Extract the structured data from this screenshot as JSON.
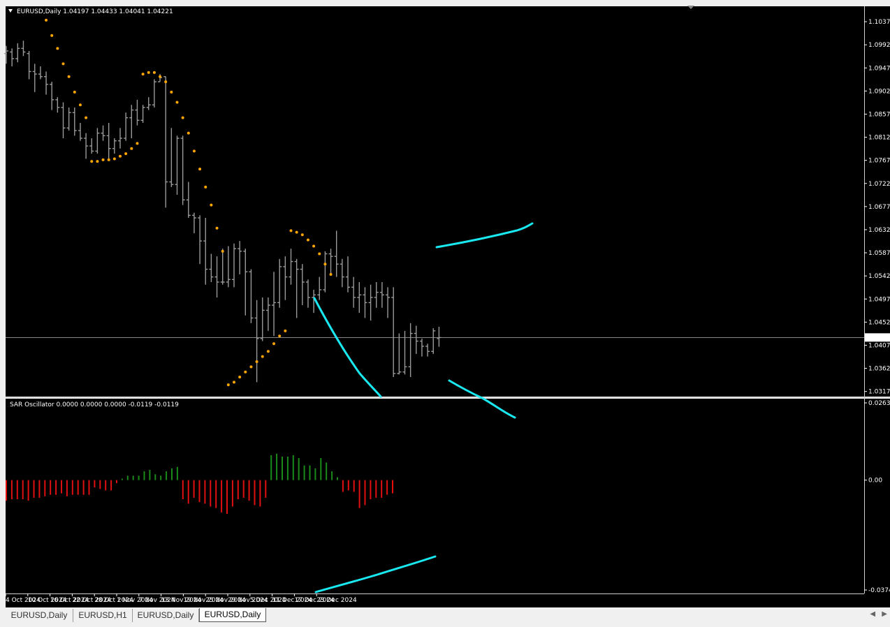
{
  "window": {
    "symbol_header": "EURUSD,Daily",
    "ohlc": "1.04197 1.04433 1.04041 1.04221"
  },
  "oscillator": {
    "header": "SAR Oscillator 0.0000 0.0000 0.0000 -0.0119 -0.0119"
  },
  "tabs": [
    {
      "label": "EURUSD,Daily",
      "active": false
    },
    {
      "label": "EURUSD,H1",
      "active": false
    },
    {
      "label": "EURUSD,Daily",
      "active": false
    },
    {
      "label": "EURUSD,Daily",
      "active": true
    }
  ],
  "colors": {
    "background": "#000000",
    "bars": "#9a9a9a",
    "sar_dots": "#ffa500",
    "osc_positive": "#1a8a1a",
    "osc_negative": "#e01010",
    "trendlines": "#19e8f0",
    "grid_line": "#b0b0b0",
    "tab_background": "#f0f0f0"
  },
  "chart_data": [
    {
      "type": "ohlc",
      "name": "EURUSD,Daily",
      "current_price": 1.04221,
      "current_price_label": "1.04221",
      "y_ticks": [
        "1.10370",
        "1.09920",
        "1.09470",
        "1.09020",
        "1.08570",
        "1.08120",
        "1.07670",
        "1.07220",
        "1.06770",
        "1.06320",
        "1.05870",
        "1.05420",
        "1.04970",
        "1.04520",
        "1.04070",
        "1.03620",
        "1.03170"
      ],
      "ylim": [
        1.0307,
        1.1067
      ],
      "x_labels": [
        {
          "label": "4 Oct 2024",
          "index": 0
        },
        {
          "label": "10 Oct 2024",
          "index": 4
        },
        {
          "label": "16 Oct 2024",
          "index": 8
        },
        {
          "label": "22 Oct 2024",
          "index": 12
        },
        {
          "label": "28 Oct 2024",
          "index": 16
        },
        {
          "label": "1 Nov 2024",
          "index": 20
        },
        {
          "label": "7 Nov 2024",
          "index": 24
        },
        {
          "label": "13 Nov 2024",
          "index": 28
        },
        {
          "label": "19 Nov 2024",
          "index": 32
        },
        {
          "label": "25 Nov 2024",
          "index": 36
        },
        {
          "label": "29 Nov 2024",
          "index": 40
        },
        {
          "label": "5 Dec 2024",
          "index": 44
        },
        {
          "label": "11 Dec 2024",
          "index": 48
        },
        {
          "label": "17 Dec 2024",
          "index": 52
        },
        {
          "label": "23 Dec 2024",
          "index": 56
        }
      ],
      "ohlc": [
        [
          1.0975,
          1.099,
          1.0955,
          1.098
        ],
        [
          1.0978,
          1.0985,
          1.095,
          1.0965
        ],
        [
          1.0965,
          1.0995,
          1.0958,
          1.0985
        ],
        [
          1.0985,
          1.1,
          1.097,
          1.0978
        ],
        [
          1.0975,
          1.098,
          1.0925,
          1.094
        ],
        [
          1.094,
          1.0955,
          1.09,
          1.0935
        ],
        [
          1.0935,
          1.095,
          1.0925,
          1.093
        ],
        [
          1.093,
          1.094,
          1.0895,
          1.0915
        ],
        [
          1.0915,
          1.092,
          1.0865,
          1.0885
        ],
        [
          1.0885,
          1.089,
          1.086,
          1.087
        ],
        [
          1.087,
          1.088,
          1.081,
          1.083
        ],
        [
          1.083,
          1.087,
          1.0825,
          1.086
        ],
        [
          1.086,
          1.087,
          1.0815,
          1.0825
        ],
        [
          1.0825,
          1.084,
          1.0805,
          1.081
        ],
        [
          1.081,
          1.082,
          1.077,
          1.0795
        ],
        [
          1.0795,
          1.081,
          1.078,
          1.0785
        ],
        [
          1.0785,
          1.083,
          1.078,
          1.082
        ],
        [
          1.082,
          1.0835,
          1.0805,
          1.0815
        ],
        [
          1.0815,
          1.084,
          1.077,
          1.079
        ],
        [
          1.079,
          1.081,
          1.078,
          1.0805
        ],
        [
          1.0805,
          1.083,
          1.079,
          1.081
        ],
        [
          1.081,
          1.086,
          1.0805,
          1.085
        ],
        [
          1.085,
          1.0875,
          1.081,
          1.0865
        ],
        [
          1.0865,
          1.0885,
          1.0835,
          1.0845
        ],
        [
          1.0845,
          1.0875,
          1.084,
          1.087
        ],
        [
          1.087,
          1.089,
          1.0865,
          1.0875
        ],
        [
          1.0875,
          1.0925,
          1.087,
          1.092
        ],
        [
          1.092,
          1.0935,
          1.092,
          1.0928
        ],
        [
          1.093,
          1.093,
          1.0675,
          1.0725
        ],
        [
          1.0725,
          1.083,
          1.0715,
          1.072
        ],
        [
          1.072,
          1.0815,
          1.07,
          1.081
        ],
        [
          1.081,
          1.0815,
          1.068,
          1.069
        ],
        [
          1.069,
          1.0725,
          1.0655,
          1.066
        ],
        [
          1.066,
          1.0665,
          1.0625,
          1.0655
        ],
        [
          1.0655,
          1.066,
          1.0565,
          1.061
        ],
        [
          1.061,
          1.0655,
          1.0525,
          1.0555
        ],
        [
          1.0555,
          1.0585,
          1.053,
          1.054
        ],
        [
          1.054,
          1.058,
          1.05,
          1.053
        ],
        [
          1.053,
          1.0595,
          1.0525,
          1.053
        ],
        [
          1.053,
          1.06,
          1.052,
          1.0535
        ],
        [
          1.0535,
          1.0605,
          1.052,
          1.0595
        ],
        [
          1.0595,
          1.061,
          1.0545,
          1.059
        ],
        [
          1.059,
          1.0595,
          1.0465,
          1.055
        ],
        [
          1.055,
          1.0555,
          1.045,
          1.046
        ],
        [
          1.046,
          1.0495,
          1.0335,
          1.042
        ],
        [
          1.042,
          1.05,
          1.0415,
          1.0475
        ],
        [
          1.0475,
          1.05,
          1.0435,
          1.0485
        ],
        [
          1.0485,
          1.055,
          1.0425,
          1.049
        ],
        [
          1.049,
          1.0575,
          1.048,
          1.056
        ],
        [
          1.056,
          1.058,
          1.0495,
          1.054
        ],
        [
          1.054,
          1.0595,
          1.0525,
          1.057
        ],
        [
          1.057,
          1.0575,
          1.046,
          1.0555
        ],
        [
          1.0555,
          1.0565,
          1.0485,
          1.053
        ],
        [
          1.053,
          1.0535,
          1.048,
          1.05
        ],
        [
          1.05,
          1.0515,
          1.047,
          1.0505
        ],
        [
          1.0505,
          1.054,
          1.0495,
          1.0515
        ],
        [
          1.0515,
          1.059,
          1.051,
          1.0585
        ],
        [
          1.0585,
          1.0595,
          1.0545,
          1.058
        ],
        [
          1.058,
          1.063,
          1.054,
          1.0565
        ],
        [
          1.0565,
          1.0575,
          1.052,
          1.054
        ],
        [
          1.054,
          1.058,
          1.051,
          1.052
        ],
        [
          1.052,
          1.054,
          1.048,
          1.05
        ],
        [
          1.05,
          1.053,
          1.047,
          1.0505
        ],
        [
          1.0505,
          1.052,
          1.046,
          1.049
        ],
        [
          1.049,
          1.0525,
          1.0455,
          1.05
        ],
        [
          1.05,
          1.053,
          1.048,
          1.051
        ],
        [
          1.051,
          1.053,
          1.048,
          1.0505
        ],
        [
          1.0505,
          1.052,
          1.046,
          1.05
        ],
        [
          1.05,
          1.052,
          1.0345,
          1.0352
        ],
        [
          1.0352,
          1.043,
          1.035,
          1.0355
        ],
        [
          1.0355,
          1.0435,
          1.035,
          1.0365
        ],
        [
          1.0365,
          1.045,
          1.0345,
          1.043
        ],
        [
          1.043,
          1.0445,
          1.039,
          1.0415
        ],
        [
          1.0415,
          1.042,
          1.0385,
          1.0405
        ],
        [
          1.0405,
          1.041,
          1.0385,
          1.0395
        ],
        [
          1.0395,
          1.044,
          1.039,
          1.0435
        ],
        [
          1.042,
          1.0443,
          1.0404,
          1.0422
        ]
      ],
      "sar": [
        [
          7,
          1.104
        ],
        [
          8,
          1.101
        ],
        [
          9,
          1.0985
        ],
        [
          10,
          1.0955
        ],
        [
          11,
          1.093
        ],
        [
          12,
          1.09
        ],
        [
          13,
          1.0875
        ],
        [
          14,
          1.085
        ],
        [
          15,
          1.0765
        ],
        [
          16,
          1.0765
        ],
        [
          17,
          1.0768
        ],
        [
          18,
          1.0768
        ],
        [
          19,
          1.077
        ],
        [
          20,
          1.0775
        ],
        [
          21,
          1.078
        ],
        [
          22,
          1.079
        ],
        [
          23,
          1.08
        ],
        [
          24,
          1.0935
        ],
        [
          25,
          1.0938
        ],
        [
          26,
          1.0938
        ],
        [
          27,
          1.093
        ],
        [
          28,
          1.092
        ],
        [
          29,
          1.09
        ],
        [
          30,
          1.088
        ],
        [
          31,
          1.085
        ],
        [
          32,
          1.082
        ],
        [
          33,
          1.0785
        ],
        [
          34,
          1.075
        ],
        [
          35,
          1.0715
        ],
        [
          36,
          1.068
        ],
        [
          37,
          1.0635
        ],
        [
          38,
          1.059
        ],
        [
          39,
          1.033
        ],
        [
          40,
          1.0335
        ],
        [
          41,
          1.0345
        ],
        [
          42,
          1.0355
        ],
        [
          43,
          1.0365
        ],
        [
          44,
          1.0375
        ],
        [
          45,
          1.0385
        ],
        [
          46,
          1.0395
        ],
        [
          47,
          1.041
        ],
        [
          48,
          1.0425
        ],
        [
          49,
          1.0435
        ],
        [
          50,
          1.063
        ],
        [
          51,
          1.0627
        ],
        [
          52,
          1.0622
        ],
        [
          53,
          1.0612
        ],
        [
          54,
          1.06
        ],
        [
          55,
          1.0585
        ],
        [
          56,
          1.0565
        ],
        [
          57,
          1.0545
        ]
      ]
    },
    {
      "type": "bar",
      "name": "SAR Oscillator",
      "y_ticks": [
        "0.0263",
        "0.00",
        "-0.0374"
      ],
      "ylim": [
        -0.0374,
        0.0263
      ],
      "values": [
        -0.007,
        -0.0065,
        -0.0065,
        -0.0065,
        -0.007,
        -0.006,
        -0.006,
        -0.0055,
        -0.005,
        -0.005,
        -0.0045,
        -0.0055,
        -0.005,
        -0.005,
        -0.005,
        -0.005,
        -0.0025,
        -0.003,
        -0.0035,
        -0.0035,
        -0.001,
        0.0005,
        0.0015,
        0.0015,
        0.0015,
        0.003,
        0.0035,
        0.002,
        0.0015,
        0.003,
        0.004,
        0.0045,
        -0.0065,
        -0.008,
        -0.006,
        -0.0075,
        -0.008,
        -0.009,
        -0.0095,
        -0.011,
        -0.0115,
        -0.009,
        -0.0065,
        -0.006,
        -0.007,
        -0.0085,
        -0.009,
        -0.006,
        0.0085,
        0.009,
        0.008,
        0.008,
        0.0085,
        0.0075,
        0.005,
        0.005,
        0.004,
        0.0075,
        0.006,
        0.003,
        0.001,
        -0.004,
        -0.0035,
        -0.004,
        -0.0095,
        -0.0085,
        -0.0065,
        -0.006,
        -0.006,
        -0.005,
        -0.0045
      ]
    }
  ]
}
